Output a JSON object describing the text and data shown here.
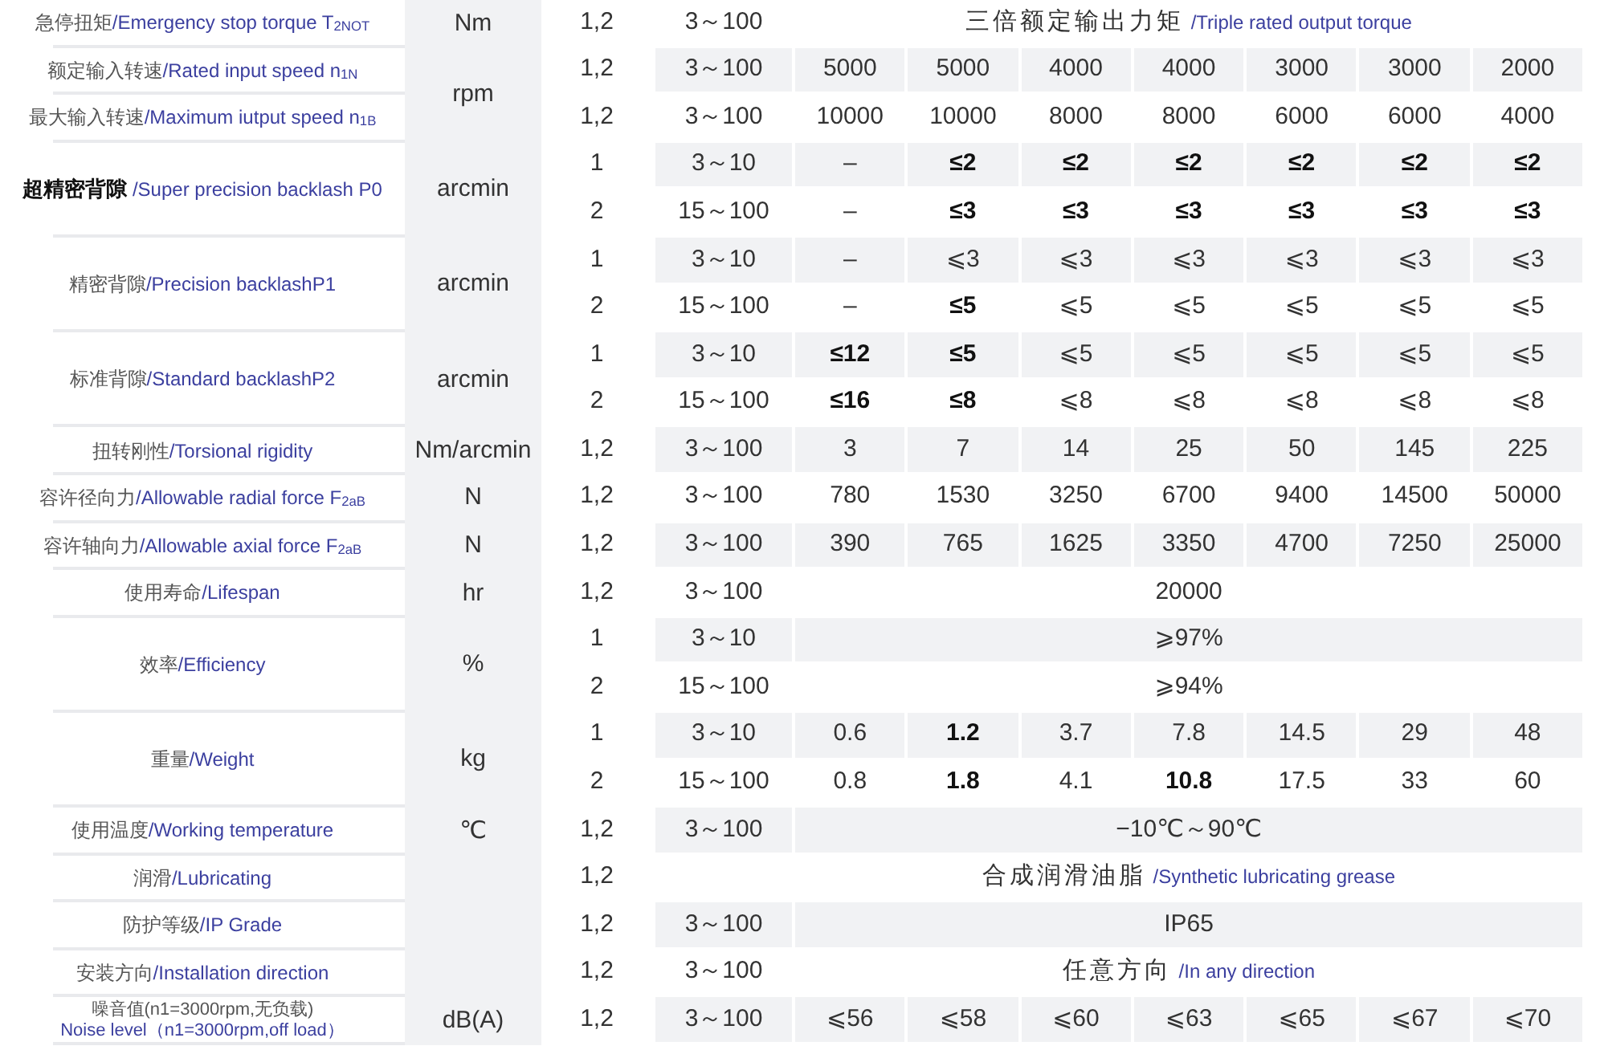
{
  "unit_groups": [
    {
      "unit": "Nm",
      "parameters": [
        {
          "kind": "inline",
          "emphasized": false,
          "name_zh": "急停扭矩",
          "name_en": "/Emergency stop torque T$_{2NOT}$",
          "rows": [
            {
              "stage": "1,2",
              "ratio": "3～100",
              "kind": "merged",
              "merged_zh": "三倍额定输出力矩",
              "merged_en": "/Triple rated output torque"
            }
          ]
        }
      ]
    },
    {
      "unit": "rpm",
      "parameters": [
        {
          "kind": "inline",
          "emphasized": false,
          "name_zh": "额定输入转速",
          "name_en": "/Rated input speed n$_{1N}$",
          "rows": [
            {
              "stage": "1,2",
              "ratio": "3～100",
              "kind": "values",
              "values": [
                {
                  "text": "5000",
                  "emphasized": false
                },
                {
                  "text": "5000",
                  "emphasized": false
                },
                {
                  "text": "4000",
                  "emphasized": false
                },
                {
                  "text": "4000",
                  "emphasized": false
                },
                {
                  "text": "3000",
                  "emphasized": false
                },
                {
                  "text": "3000",
                  "emphasized": false
                },
                {
                  "text": "2000",
                  "emphasized": false
                }
              ]
            }
          ]
        },
        {
          "kind": "inline",
          "emphasized": false,
          "name_zh": "最大输入转速",
          "name_en": "/Maximum iutput speed  n$_{1B}$",
          "rows": [
            {
              "stage": "1,2",
              "ratio": "3～100",
              "kind": "values",
              "values": [
                {
                  "text": "10000",
                  "emphasized": false
                },
                {
                  "text": "10000",
                  "emphasized": false
                },
                {
                  "text": "8000",
                  "emphasized": false
                },
                {
                  "text": "8000",
                  "emphasized": false
                },
                {
                  "text": "6000",
                  "emphasized": false
                },
                {
                  "text": "6000",
                  "emphasized": false
                },
                {
                  "text": "4000",
                  "emphasized": false
                }
              ]
            }
          ]
        }
      ]
    },
    {
      "unit": "arcmin",
      "parameters": [
        {
          "kind": "inline",
          "emphasized": true,
          "name_zh": "超精密背隙",
          "name_en": "/Super precision backlash  P0",
          "rows": [
            {
              "stage": "1",
              "ratio": "3～10",
              "kind": "values",
              "values": [
                {
                  "text": "–",
                  "emphasized": false
                },
                {
                  "text": "≤2",
                  "emphasized": true
                },
                {
                  "text": "≤2",
                  "emphasized": true
                },
                {
                  "text": "≤2",
                  "emphasized": true
                },
                {
                  "text": "≤2",
                  "emphasized": true
                },
                {
                  "text": "≤2",
                  "emphasized": true
                },
                {
                  "text": "≤2",
                  "emphasized": true
                }
              ]
            },
            {
              "stage": "2",
              "ratio": "15～100",
              "kind": "values",
              "values": [
                {
                  "text": "–",
                  "emphasized": false
                },
                {
                  "text": "≤3",
                  "emphasized": true
                },
                {
                  "text": "≤3",
                  "emphasized": true
                },
                {
                  "text": "≤3",
                  "emphasized": true
                },
                {
                  "text": "≤3",
                  "emphasized": true
                },
                {
                  "text": "≤3",
                  "emphasized": true
                },
                {
                  "text": "≤3",
                  "emphasized": true
                }
              ]
            }
          ]
        }
      ]
    },
    {
      "unit": "arcmin",
      "parameters": [
        {
          "kind": "inline",
          "emphasized": false,
          "name_zh": "精密背隙",
          "name_en": "/Precision backlashP1",
          "rows": [
            {
              "stage": "1",
              "ratio": "3～10",
              "kind": "values",
              "values": [
                {
                  "text": "–",
                  "emphasized": false
                },
                {
                  "text": "⩽3",
                  "emphasized": false
                },
                {
                  "text": "⩽3",
                  "emphasized": false
                },
                {
                  "text": "⩽3",
                  "emphasized": false
                },
                {
                  "text": "⩽3",
                  "emphasized": false
                },
                {
                  "text": "⩽3",
                  "emphasized": false
                },
                {
                  "text": "⩽3",
                  "emphasized": false
                }
              ]
            },
            {
              "stage": "2",
              "ratio": "15～100",
              "kind": "values",
              "values": [
                {
                  "text": "–",
                  "emphasized": false
                },
                {
                  "text": "≤5",
                  "emphasized": true
                },
                {
                  "text": "⩽5",
                  "emphasized": false
                },
                {
                  "text": "⩽5",
                  "emphasized": false
                },
                {
                  "text": "⩽5",
                  "emphasized": false
                },
                {
                  "text": "⩽5",
                  "emphasized": false
                },
                {
                  "text": "⩽5",
                  "emphasized": false
                }
              ]
            }
          ]
        }
      ]
    },
    {
      "unit": "arcmin",
      "parameters": [
        {
          "kind": "inline",
          "emphasized": false,
          "name_zh": "标准背隙",
          "name_en": "/Standard backlashP2",
          "rows": [
            {
              "stage": "1",
              "ratio": "3～10",
              "kind": "values",
              "values": [
                {
                  "text": "≤12",
                  "emphasized": true
                },
                {
                  "text": "≤5",
                  "emphasized": true
                },
                {
                  "text": "⩽5",
                  "emphasized": false
                },
                {
                  "text": "⩽5",
                  "emphasized": false
                },
                {
                  "text": "⩽5",
                  "emphasized": false
                },
                {
                  "text": "⩽5",
                  "emphasized": false
                },
                {
                  "text": "⩽5",
                  "emphasized": false
                }
              ]
            },
            {
              "stage": "2",
              "ratio": "15～100",
              "kind": "values",
              "values": [
                {
                  "text": "≤16",
                  "emphasized": true
                },
                {
                  "text": "≤8",
                  "emphasized": true
                },
                {
                  "text": "⩽8",
                  "emphasized": false
                },
                {
                  "text": "⩽8",
                  "emphasized": false
                },
                {
                  "text": "⩽8",
                  "emphasized": false
                },
                {
                  "text": "⩽8",
                  "emphasized": false
                },
                {
                  "text": "⩽8",
                  "emphasized": false
                }
              ]
            }
          ]
        }
      ]
    },
    {
      "unit": "Nm/arcmin",
      "parameters": [
        {
          "kind": "inline",
          "emphasized": false,
          "name_zh": "扭转刚性",
          "name_en": "/Torsional rigidity",
          "rows": [
            {
              "stage": "1,2",
              "ratio": "3～100",
              "kind": "values",
              "values": [
                {
                  "text": "3",
                  "emphasized": false
                },
                {
                  "text": "7",
                  "emphasized": false
                },
                {
                  "text": "14",
                  "emphasized": false
                },
                {
                  "text": "25",
                  "emphasized": false
                },
                {
                  "text": "50",
                  "emphasized": false
                },
                {
                  "text": "145",
                  "emphasized": false
                },
                {
                  "text": "225",
                  "emphasized": false
                }
              ]
            }
          ]
        }
      ]
    },
    {
      "unit": "N",
      "parameters": [
        {
          "kind": "inline",
          "emphasized": false,
          "name_zh": "容许径向力",
          "name_en": "/Allowable radial force F$_{2aB}$",
          "rows": [
            {
              "stage": "1,2",
              "ratio": "3～100",
              "kind": "values",
              "values": [
                {
                  "text": "780",
                  "emphasized": false
                },
                {
                  "text": "1530",
                  "emphasized": false
                },
                {
                  "text": "3250",
                  "emphasized": false
                },
                {
                  "text": "6700",
                  "emphasized": false
                },
                {
                  "text": "9400",
                  "emphasized": false
                },
                {
                  "text": "14500",
                  "emphasized": false
                },
                {
                  "text": "50000",
                  "emphasized": false
                }
              ]
            }
          ]
        }
      ]
    },
    {
      "unit": "N",
      "parameters": [
        {
          "kind": "inline",
          "emphasized": false,
          "name_zh": "容许轴向力",
          "name_en": "/Allowable axial force F$_{2aB}$",
          "rows": [
            {
              "stage": "1,2",
              "ratio": "3～100",
              "kind": "values",
              "values": [
                {
                  "text": "390",
                  "emphasized": false
                },
                {
                  "text": "765",
                  "emphasized": false
                },
                {
                  "text": "1625",
                  "emphasized": false
                },
                {
                  "text": "3350",
                  "emphasized": false
                },
                {
                  "text": "4700",
                  "emphasized": false
                },
                {
                  "text": "7250",
                  "emphasized": false
                },
                {
                  "text": "25000",
                  "emphasized": false
                }
              ]
            }
          ]
        }
      ]
    },
    {
      "unit": "hr",
      "parameters": [
        {
          "kind": "inline",
          "emphasized": false,
          "name_zh": "使用寿命",
          "name_en": "/Lifespan",
          "rows": [
            {
              "stage": "1,2",
              "ratio": "3～100",
              "kind": "merged",
              "merged_zh": "20000"
            }
          ]
        }
      ]
    },
    {
      "unit": "%",
      "parameters": [
        {
          "kind": "inline",
          "emphasized": false,
          "name_zh": "效率",
          "name_en": "/Efficiency",
          "rows": [
            {
              "stage": "1",
              "ratio": "3～10",
              "kind": "merged",
              "merged_zh": "⩾97%"
            },
            {
              "stage": "2",
              "ratio": "15～100",
              "kind": "merged",
              "merged_zh": "⩾94%"
            }
          ]
        }
      ]
    },
    {
      "unit": "kg",
      "parameters": [
        {
          "kind": "inline",
          "emphasized": false,
          "name_zh": "重量",
          "name_en": "/Weight",
          "rows": [
            {
              "stage": "1",
              "ratio": "3～10",
              "kind": "values",
              "values": [
                {
                  "text": "0.6",
                  "emphasized": false
                },
                {
                  "text": "1.2",
                  "emphasized": true
                },
                {
                  "text": "3.7",
                  "emphasized": false
                },
                {
                  "text": "7.8",
                  "emphasized": false
                },
                {
                  "text": "14.5",
                  "emphasized": false
                },
                {
                  "text": "29",
                  "emphasized": false
                },
                {
                  "text": "48",
                  "emphasized": false
                }
              ]
            },
            {
              "stage": "2",
              "ratio": "15～100",
              "kind": "values",
              "values": [
                {
                  "text": "0.8",
                  "emphasized": false
                },
                {
                  "text": "1.8",
                  "emphasized": true
                },
                {
                  "text": "4.1",
                  "emphasized": false
                },
                {
                  "text": "10.8",
                  "emphasized": true
                },
                {
                  "text": "17.5",
                  "emphasized": false
                },
                {
                  "text": "33",
                  "emphasized": false
                },
                {
                  "text": "60",
                  "emphasized": false
                }
              ]
            }
          ]
        }
      ]
    },
    {
      "unit": "℃",
      "parameters": [
        {
          "kind": "inline",
          "emphasized": false,
          "name_zh": "使用温度",
          "name_en": "/Working temperature",
          "rows": [
            {
              "stage": "1,2",
              "ratio": "3～100",
              "kind": "merged",
              "merged_zh": "−10℃～90℃"
            }
          ]
        }
      ]
    },
    {
      "parameters": [
        {
          "kind": "inline",
          "emphasized": false,
          "name_zh": "润滑",
          "name_en": "/Lubricating",
          "rows": [
            {
              "stage": "1,2",
              "kind": "merged",
              "merged_zh": "合成润滑油脂",
              "merged_en": "/Synthetic lubricating grease"
            }
          ]
        },
        {
          "kind": "inline",
          "emphasized": false,
          "name_zh": "防护等级",
          "name_en": "/IP Grade",
          "rows": [
            {
              "stage": "1,2",
              "ratio": "3～100",
              "kind": "merged",
              "merged_zh": "IP65"
            }
          ]
        },
        {
          "kind": "inline",
          "emphasized": false,
          "name_zh": "安装方向",
          "name_en": "/Installation direction",
          "rows": [
            {
              "stage": "1,2",
              "ratio": "3～100",
              "kind": "merged",
              "merged_zh": "任意方向",
              "merged_en": "/In any direction"
            }
          ]
        }
      ]
    },
    {
      "unit": "dB(A)",
      "parameters": [
        {
          "kind": "stacked",
          "emphasized": false,
          "name_zh": "噪音值(n1=3000rpm,无负载)",
          "name_en": "Noise level（n1=3000rpm,off load）",
          "rows": [
            {
              "stage": "1,2",
              "ratio": "3～100",
              "kind": "values",
              "values": [
                {
                  "text": "⩽56",
                  "emphasized": false
                },
                {
                  "text": "⩽58",
                  "emphasized": false
                },
                {
                  "text": "⩽60",
                  "emphasized": false
                },
                {
                  "text": "⩽63",
                  "emphasized": false
                },
                {
                  "text": "⩽65",
                  "emphasized": false
                },
                {
                  "text": "⩽67",
                  "emphasized": false
                },
                {
                  "text": "⩽70",
                  "emphasized": false
                }
              ]
            }
          ]
        }
      ]
    }
  ]
}
